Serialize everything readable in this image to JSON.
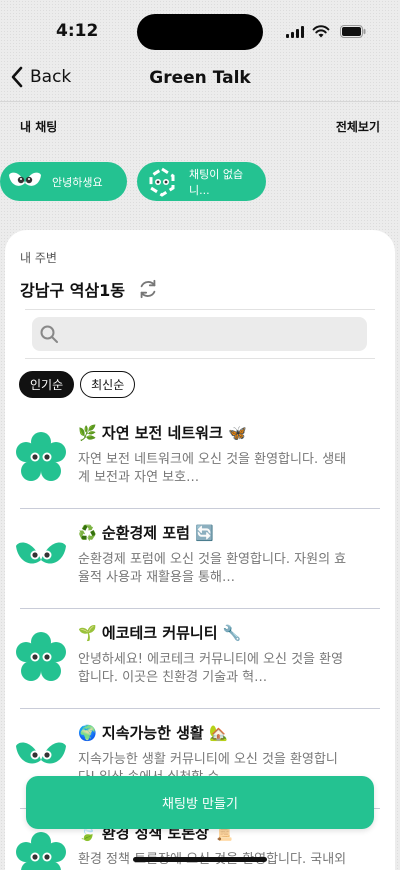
{
  "status_bar": {
    "time": "4:12"
  },
  "nav": {
    "back_label": "Back",
    "title": "Green Talk"
  },
  "my_chats": {
    "heading": "내 채팅",
    "see_all": "전체보기",
    "chips": [
      {
        "label": "안녕하생요"
      },
      {
        "label": "채팅이 없습니..."
      }
    ]
  },
  "nearby": {
    "label": "내 주변",
    "location": "강남구 역삼1동",
    "search_placeholder": "",
    "sort_options": [
      "인기순",
      "최신순"
    ],
    "sort_selected": "인기순"
  },
  "rooms": [
    {
      "title": "🌿 자연 보전 네트워크 🦋",
      "description": "자연 보전 네트워크에 오신 것을 환영합니다. 생태계 보전과 자연 보호…",
      "avatar": "flower-mascot-icon"
    },
    {
      "title": "♻️ 순환경제 포럼 🔄",
      "description": "순환경제 포럼에 오신 것을 환영합니다. 자원의 효율적 사용과 재활용을 통해…",
      "avatar": "leaf-mascot-icon"
    },
    {
      "title": "🌱 에코테크 커뮤니티 🔧",
      "description": "안녕하세요! 에코테크 커뮤니티에 오신 것을 환영합니다. 이곳은 친환경 기술과 혁…",
      "avatar": "flower-mascot-icon"
    },
    {
      "title": "🌍 지속가능한 생활 🏡",
      "description": "지속가능한 생활 커뮤니티에 오신 것을 환영합니다! 일상 속에서 실천할 수…",
      "avatar": "leaf-mascot-icon"
    },
    {
      "title": "🍃 환경 정책 토론장 📜",
      "description": "환경 정책 토론장에 오신 것을 환영합니다. 국내외 환경 정책과 법규…",
      "avatar": "flower-mascot-icon"
    }
  ],
  "create_button": "채팅방 만들기",
  "colors": {
    "brand": "#24c291",
    "text": "#111111",
    "muted": "#777777"
  }
}
